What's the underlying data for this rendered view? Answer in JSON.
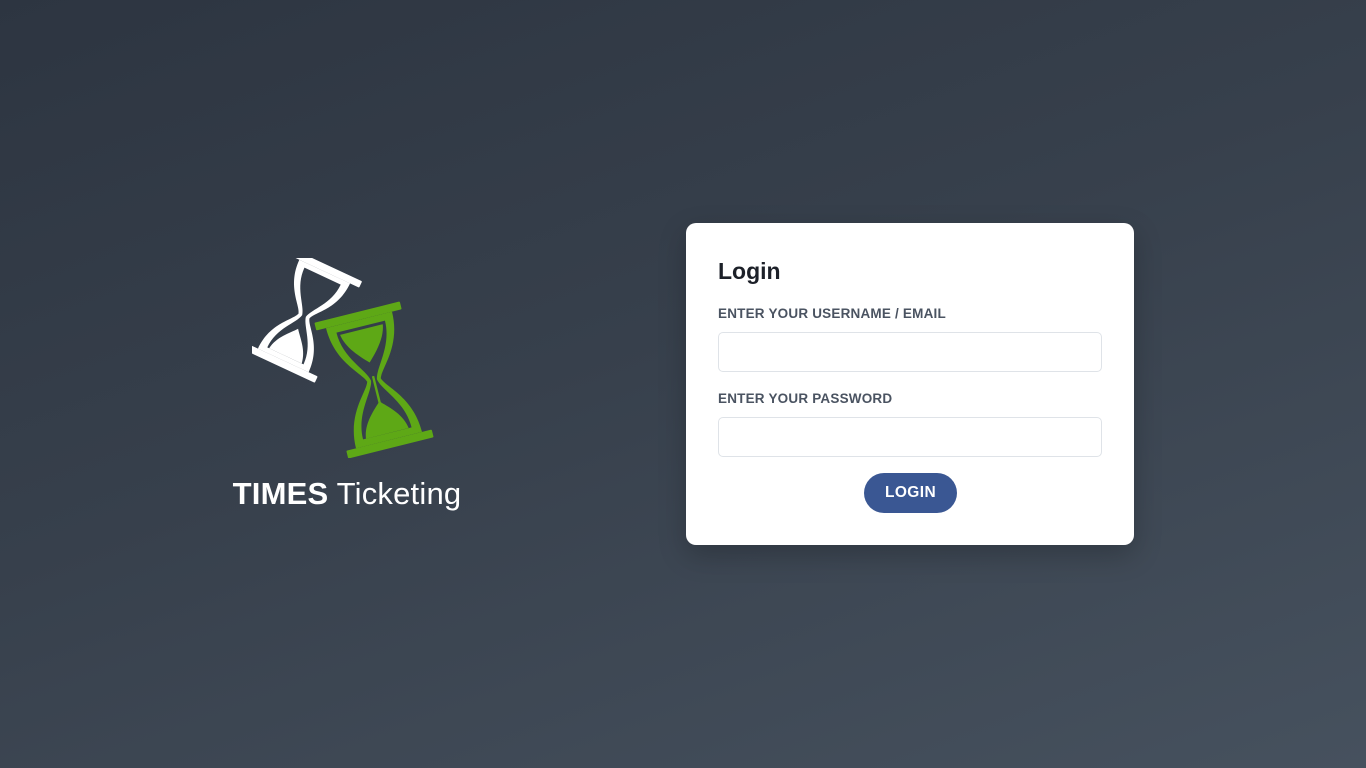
{
  "brand": {
    "name_strong": "TIMES",
    "name_light": " Ticketing",
    "logo_icon": "hourglass-pair-icon",
    "colors": {
      "primary_hourglass": "#ffffff",
      "secondary_hourglass": "#5ea816"
    }
  },
  "login_form": {
    "title": "Login",
    "username_label": "ENTER YOUR USERNAME / EMAIL",
    "username_value": "",
    "password_label": "ENTER YOUR PASSWORD",
    "password_value": "",
    "submit_label": "LOGIN"
  },
  "colors": {
    "button_background": "#3a5793",
    "card_background": "#ffffff",
    "page_background_start": "#2d3541",
    "page_background_end": "#46515e"
  }
}
